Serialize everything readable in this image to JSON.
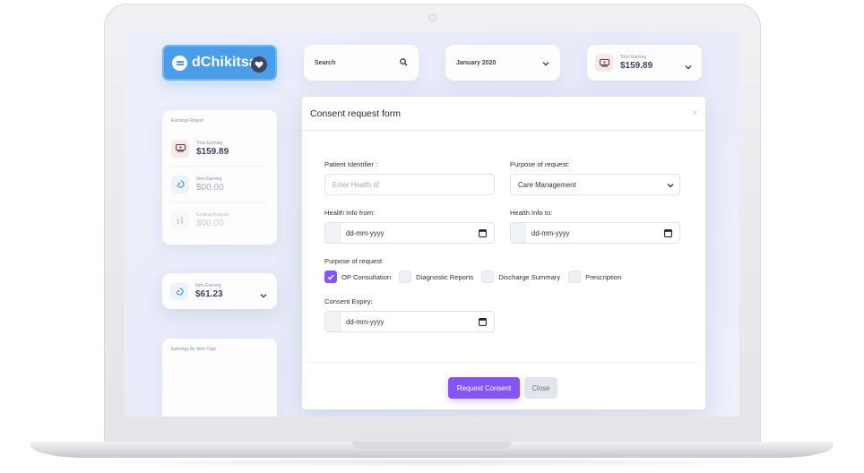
{
  "brand": {
    "name": "dChikitsa",
    "accent": "#2f8fe6"
  },
  "header": {
    "search_label": "Search",
    "date_filter": "January 2020",
    "total_earning_label": "Total Earning",
    "total_earning_value": "$159.89"
  },
  "earnings_report": {
    "title": "Earnings Report",
    "rows": [
      {
        "label": "Total Earning",
        "value": "$159.89",
        "icon": "money-icon"
      },
      {
        "label": "Item Earning",
        "value": "$00.00",
        "icon": "swirl-icon"
      },
      {
        "label": "Costing Analysis",
        "value": "$00.00",
        "icon": "chart-icon"
      }
    ]
  },
  "item_earning": {
    "label": "Item Earning",
    "value": "$61.23"
  },
  "earnings_by_type": {
    "title": "Earnings By Item Type"
  },
  "modal": {
    "title": "Consent request form",
    "close": "×",
    "patient_identifier_label": "Patient Identifier :",
    "patient_identifier_placeholder": "Enter Health Id",
    "purpose_label": "Purpose of request:",
    "purpose_value": "Care Management",
    "health_from_label": "Health Info from:",
    "health_to_label": "Health Info to:",
    "date_placeholder": "dd-mm-yyyy",
    "purpose_group_label": "Purpose of request",
    "purposes": [
      {
        "label": "OP Consultation",
        "checked": true
      },
      {
        "label": "Diagnostic Reports",
        "checked": false
      },
      {
        "label": "Discharge Summary",
        "checked": false
      },
      {
        "label": "Prescription",
        "checked": false
      }
    ],
    "consent_expiry_label": "Consent Expiry:",
    "submit_label": "Request Consent",
    "close_label": "Close",
    "primary_color": "#8454f4"
  }
}
